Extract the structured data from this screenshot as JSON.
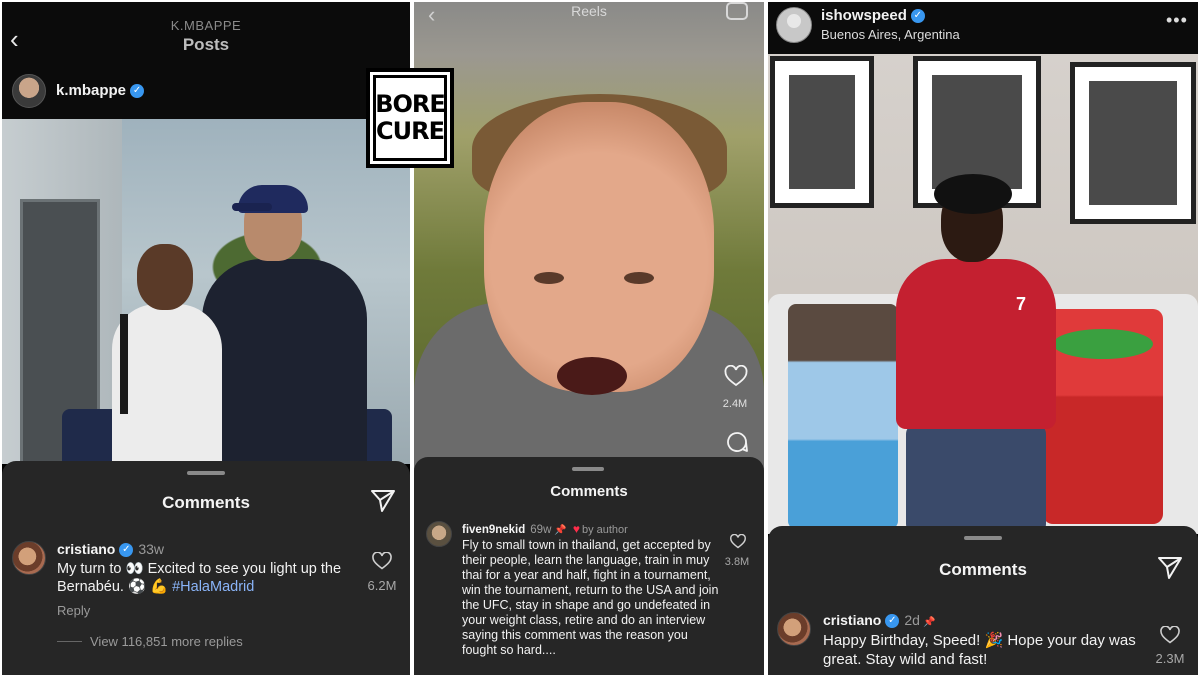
{
  "logo": {
    "line1": "BORE",
    "line2": "CURE"
  },
  "panel1": {
    "header_subtitle": "K.MBAPPE",
    "header_title": "Posts",
    "username": "k.mbappe",
    "comments_title": "Comments",
    "comment": {
      "user": "cristiano",
      "time": "33w",
      "text_part1": "My turn to 👀 Excited to see you light up the Bernabéu. ⚽️ 💪 ",
      "hashtag": "#HalaMadrid",
      "likes": "6.2M",
      "reply_label": "Reply",
      "more_replies": "View 116,851 more replies"
    }
  },
  "panel2": {
    "header_title": "Reels",
    "side_likes": "2.4M",
    "comments_title": "Comments",
    "comment": {
      "user": "fiven9nekid",
      "time": "69w",
      "by_author": "by author",
      "text": "Fly to small town in thailand, get accepted by their people, learn the language, train in muy thai for a year and half, fight in a tournament, win the tournament, return to the USA and join the UFC, stay in shape and go undefeated in your weight class, retire and do an interview saying this comment was the reason you fought so hard....",
      "likes": "3.8M"
    }
  },
  "panel3": {
    "username": "ishowspeed",
    "location": "Buenos Aires, Argentina",
    "more": "•••",
    "jersey_number": "7",
    "comments_title": "Comments",
    "comment": {
      "user": "cristiano",
      "time": "2d",
      "text": "Happy Birthday, Speed! 🎉 Hope your day was great. Stay wild and fast!",
      "likes": "2.3M"
    }
  },
  "colors": {
    "sheet": "#262626",
    "verified": "#3897f0",
    "hashtag": "#8ab4f8",
    "author_heart": "#ff2d4a"
  }
}
